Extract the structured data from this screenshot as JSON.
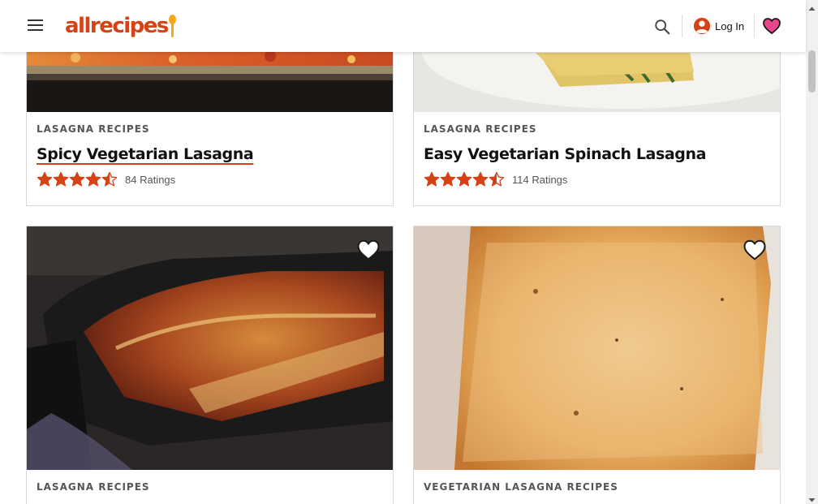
{
  "header": {
    "logo_text": "allrecipes",
    "login_label": "Log In",
    "brand_color": "#d54215",
    "accent_color": "#f3a81b",
    "icons": [
      "hamburger-menu-icon",
      "search-icon",
      "user-icon",
      "heart-icon"
    ]
  },
  "cards": [
    {
      "tag": "LASAGNA RECIPES",
      "title": "Spicy Vegetarian Lasagna",
      "stars": 4.5,
      "ratings": "84 Ratings"
    },
    {
      "tag": "LASAGNA RECIPES",
      "title": "Easy Vegetarian Spinach Lasagna",
      "stars": 4.5,
      "ratings": "114 Ratings"
    },
    {
      "tag": "LASAGNA RECIPES"
    },
    {
      "tag": "VEGETARIAN LASAGNA RECIPES"
    }
  ],
  "star_color": "#d54215"
}
